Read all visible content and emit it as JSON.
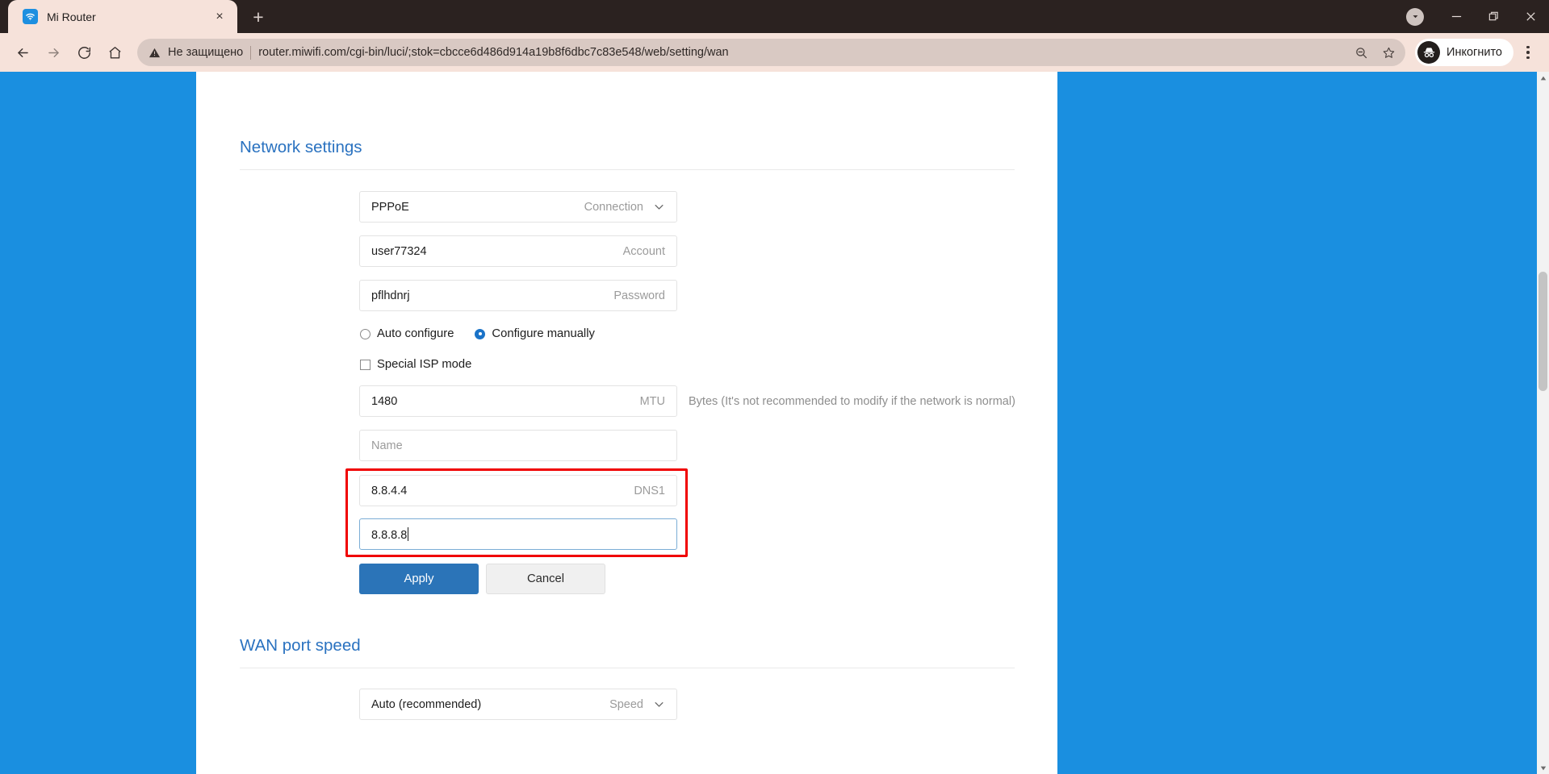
{
  "browser": {
    "tab": {
      "title": "Mi Router",
      "favicon": "wifi-icon",
      "close": "×"
    },
    "new_tab": "+",
    "window_controls": {
      "dropdown": "▼",
      "minimize": "—",
      "maximize": "❐",
      "close": "✕"
    },
    "nav": {
      "back": "←",
      "forward": "→",
      "reload": "⟳",
      "home": "⌂"
    },
    "omnibox": {
      "security_label": "Не защищено",
      "url": "router.miwifi.com/cgi-bin/luci/;stok=cbcce6d486d914a19b8f6dbc7c83e548/web/setting/wan",
      "zoom_icon": "zoom-out-icon",
      "bookmark_icon": "star-icon"
    },
    "profile": {
      "label": "Инкогнито",
      "icon": "incognito-icon"
    },
    "menu": "kebab-menu-icon"
  },
  "page": {
    "network_settings": {
      "title": "Network settings",
      "connection": {
        "value": "PPPoE",
        "label": "Connection"
      },
      "account": {
        "value": "user77324",
        "label": "Account"
      },
      "password": {
        "value": "pflhdnrj",
        "label": "Password"
      },
      "config_mode": {
        "auto": {
          "label": "Auto configure",
          "selected": false
        },
        "manual": {
          "label": "Configure manually",
          "selected": true
        }
      },
      "special_isp": {
        "label": "Special ISP mode",
        "checked": false
      },
      "mtu": {
        "value": "1480",
        "label": "MTU",
        "hint": "Bytes (It's not recommended to modify if the network is normal)"
      },
      "name": {
        "value": "",
        "placeholder": "Name"
      },
      "dns1": {
        "value": "8.8.4.4",
        "label": "DNS1"
      },
      "dns2": {
        "value": "8.8.8.8",
        "label": ""
      },
      "apply_button": "Apply",
      "cancel_button": "Cancel"
    },
    "wan_port_speed": {
      "title": "WAN port speed",
      "speed": {
        "value": "Auto (recommended)",
        "label": "Speed"
      }
    }
  },
  "colors": {
    "accent_blue": "#2a72c0",
    "page_background": "#1a8fe0",
    "primary_button": "#2b74b8",
    "highlight_box": "#f00000",
    "radio_selected": "#1a73c8"
  }
}
